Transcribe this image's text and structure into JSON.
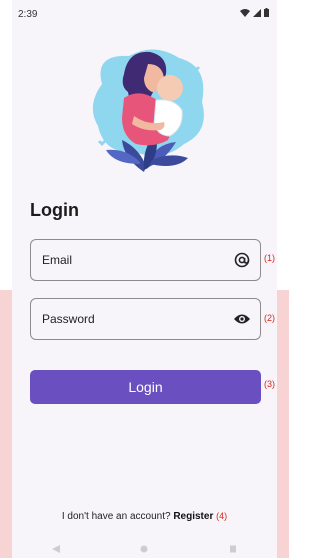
{
  "status_bar": {
    "time": "2:39"
  },
  "icons": {
    "wifi": "wifi-icon",
    "signal": "signal-icon",
    "battery": "battery-icon",
    "email_field": "at-sign-icon",
    "password_field": "eye-icon"
  },
  "login": {
    "title": "Login",
    "email_placeholder": "Email",
    "password_placeholder": "Password",
    "button_label": "Login"
  },
  "annotations": {
    "email": "(1)",
    "password": "(2)",
    "login": "(3)",
    "register": "(4)"
  },
  "footer": {
    "prompt": "I don't have an account?",
    "register_label": "Register"
  },
  "colors": {
    "accent": "#6a4fc0",
    "annotation": "#d9261c",
    "screen_background": "#f7f5fa",
    "backdrop": "#f7d3d3"
  }
}
